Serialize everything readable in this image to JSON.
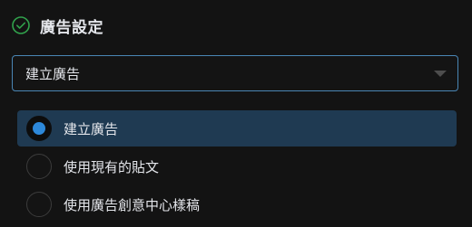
{
  "section": {
    "title": "廣告設定",
    "status_icon": "check-circle-icon"
  },
  "dropdown": {
    "selected_value": "建立廣告",
    "caret_icon": "caret-down-icon"
  },
  "options": [
    {
      "label": "建立廣告",
      "selected": true
    },
    {
      "label": "使用現有的貼文",
      "selected": false
    },
    {
      "label": "使用廣告創意中心樣稿",
      "selected": false
    }
  ],
  "colors": {
    "background": "#131313",
    "accent": "#2d88d9",
    "selected_bg": "#1f3a52",
    "check": "#31a24c",
    "dropdown_border": "#4a86b5"
  }
}
